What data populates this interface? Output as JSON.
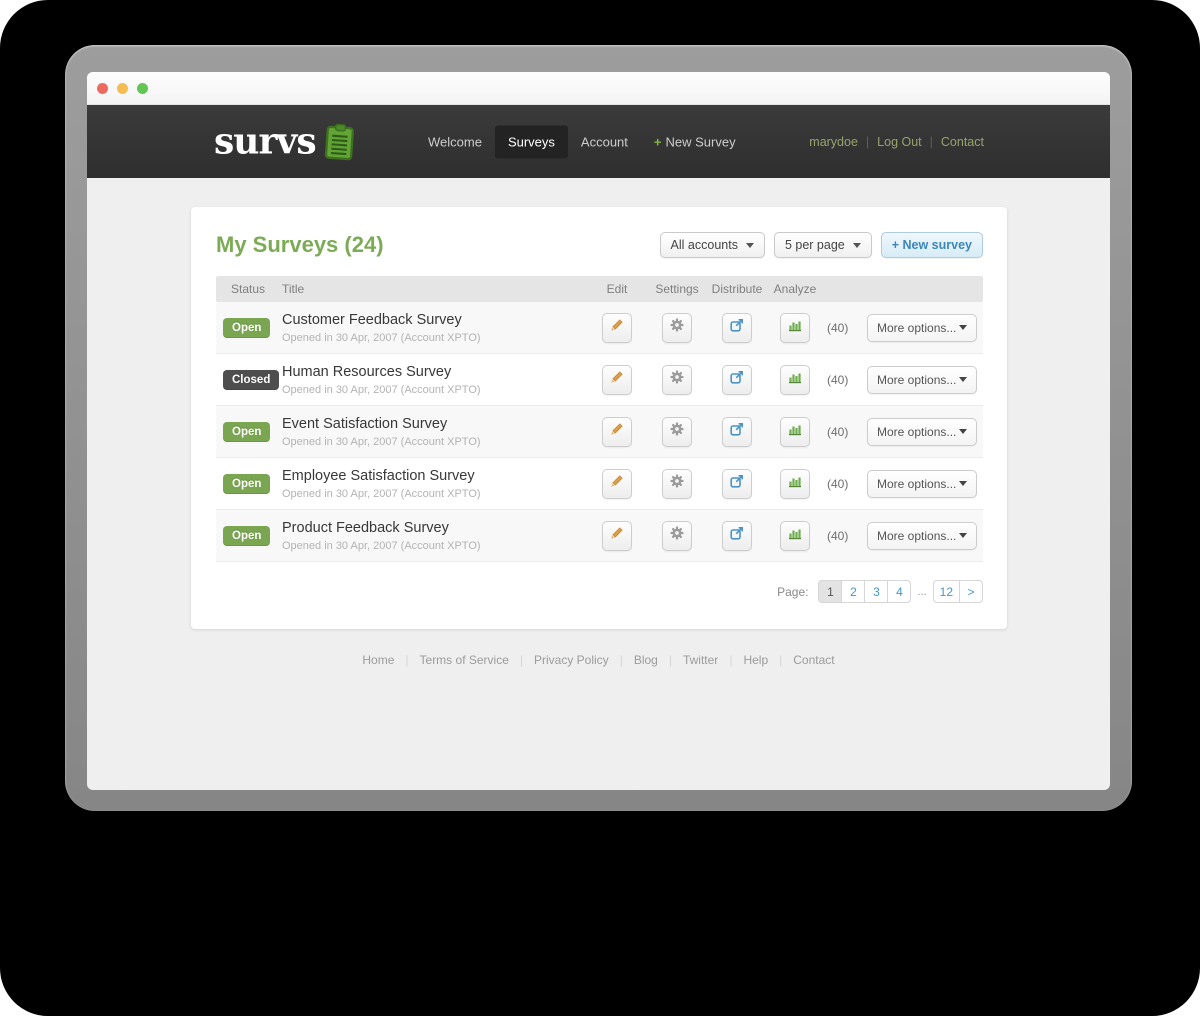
{
  "colors": {
    "accent_green": "#7cab55",
    "badge_open": "#7aa551",
    "badge_closed": "#4e4e4e",
    "link_blue": "#4596c7",
    "header_dark": "#333333",
    "user_link_olive": "#96a46c"
  },
  "header": {
    "logo_text": "survs",
    "logo_icon": "clipboard-icon",
    "nav": [
      {
        "label": "Welcome",
        "active": false
      },
      {
        "label": "Surveys",
        "active": true
      },
      {
        "label": "New Survey",
        "plus": "+",
        "active": false
      }
    ],
    "nav_account": {
      "label": "Account",
      "active": false
    },
    "user_links": {
      "username": "marydoe",
      "logout": "Log Out",
      "contact": "Contact"
    },
    "separator": "|"
  },
  "main": {
    "title": "My Surveys (24)",
    "filters": {
      "accounts": "All accounts",
      "per_page": "5 per page",
      "new_survey": "+ New survey"
    },
    "table": {
      "headers": {
        "status": "Status",
        "title": "Title",
        "edit": "Edit",
        "settings": "Settings",
        "distribute": "Distribute",
        "analyze": "Analyze"
      },
      "icons": {
        "edit": "pencil-icon",
        "settings": "gear-icon",
        "distribute": "share-icon",
        "analyze": "bar-chart-icon"
      },
      "rows": [
        {
          "status": "Open",
          "title": "Customer Feedback Survey",
          "subtitle": "Opened in 30 Apr, 2007 (Account XPTO)",
          "responses": "(40)",
          "more": "More options..."
        },
        {
          "status": "Closed",
          "title": "Human Resources Survey",
          "subtitle": "Opened in 30 Apr, 2007 (Account XPTO)",
          "responses": "(40)",
          "more": "More options..."
        },
        {
          "status": "Open",
          "title": "Event Satisfaction Survey",
          "subtitle": "Opened in 30 Apr, 2007 (Account XPTO)",
          "responses": "(40)",
          "more": "More options..."
        },
        {
          "status": "Open",
          "title": "Employee Satisfaction Survey",
          "subtitle": "Opened in 30 Apr, 2007 (Account XPTO)",
          "responses": "(40)",
          "more": "More options..."
        },
        {
          "status": "Open",
          "title": "Product Feedback Survey",
          "subtitle": "Opened in 30 Apr, 2007 (Account XPTO)",
          "responses": "(40)",
          "more": "More options..."
        }
      ]
    },
    "pagination": {
      "label": "Page:",
      "pages": [
        "1",
        "2",
        "3",
        "4"
      ],
      "current": "1",
      "ellipsis": "...",
      "last": "12",
      "next": ">"
    }
  },
  "footer": {
    "links": [
      "Home",
      "Terms of Service",
      "Privacy Policy",
      "Blog",
      "Twitter",
      "Help",
      "Contact"
    ],
    "separator": "|"
  }
}
